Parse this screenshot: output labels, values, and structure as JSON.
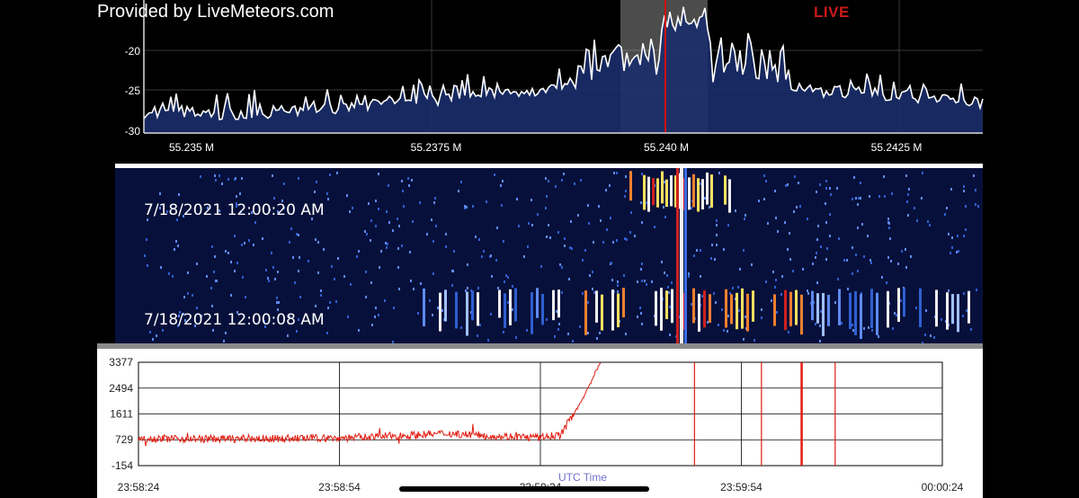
{
  "credit": "Provided by LiveMeteors.com",
  "live_label": "LIVE",
  "colors": {
    "spectrum_line": "#ffffff",
    "spectrum_fill": "#1a2e6a",
    "marker": "#d01010",
    "waterfall_bg": "#07103a",
    "plot_trace": "#e01c10",
    "plot_bg": "#ffffff"
  },
  "spectrum": {
    "y_ticks": [
      "-20",
      "-25",
      "-30"
    ],
    "x_ticks": [
      "55.235 M",
      "55.2375 M",
      "55.240 M",
      "55.2425 M"
    ],
    "marker_frequency": "55.240 M"
  },
  "waterfall": {
    "timestamps": [
      "7/18/2021 12:00:20 AM",
      "7/18/2021 12:00:08 AM"
    ]
  },
  "chart_data": {
    "type": "line",
    "title": "",
    "xlabel": "UTC Time",
    "ylabel": "",
    "x_ticks": [
      "23:58:24",
      "23:58:54",
      "23:59:24",
      "23:59:54",
      "00:00:24"
    ],
    "y_ticks": [
      "3377",
      "2494",
      "1611",
      "729",
      "-154"
    ],
    "ylim": [
      -154,
      3377
    ],
    "grid": true,
    "series": [
      {
        "x": [
          "23:58:24",
          "23:58:34",
          "23:58:44",
          "23:58:54",
          "23:59:04",
          "23:59:10",
          "23:59:16",
          "23:59:24",
          "23:59:27",
          "23:59:30",
          "23:59:33"
        ],
        "values": [
          780,
          760,
          770,
          790,
          880,
          950,
          870,
          800,
          900,
          2000,
          3377
        ]
      }
    ],
    "spikes_at": [
      "23:59:47",
      "23:59:57",
      "00:00:03",
      "00:00:08"
    ]
  }
}
